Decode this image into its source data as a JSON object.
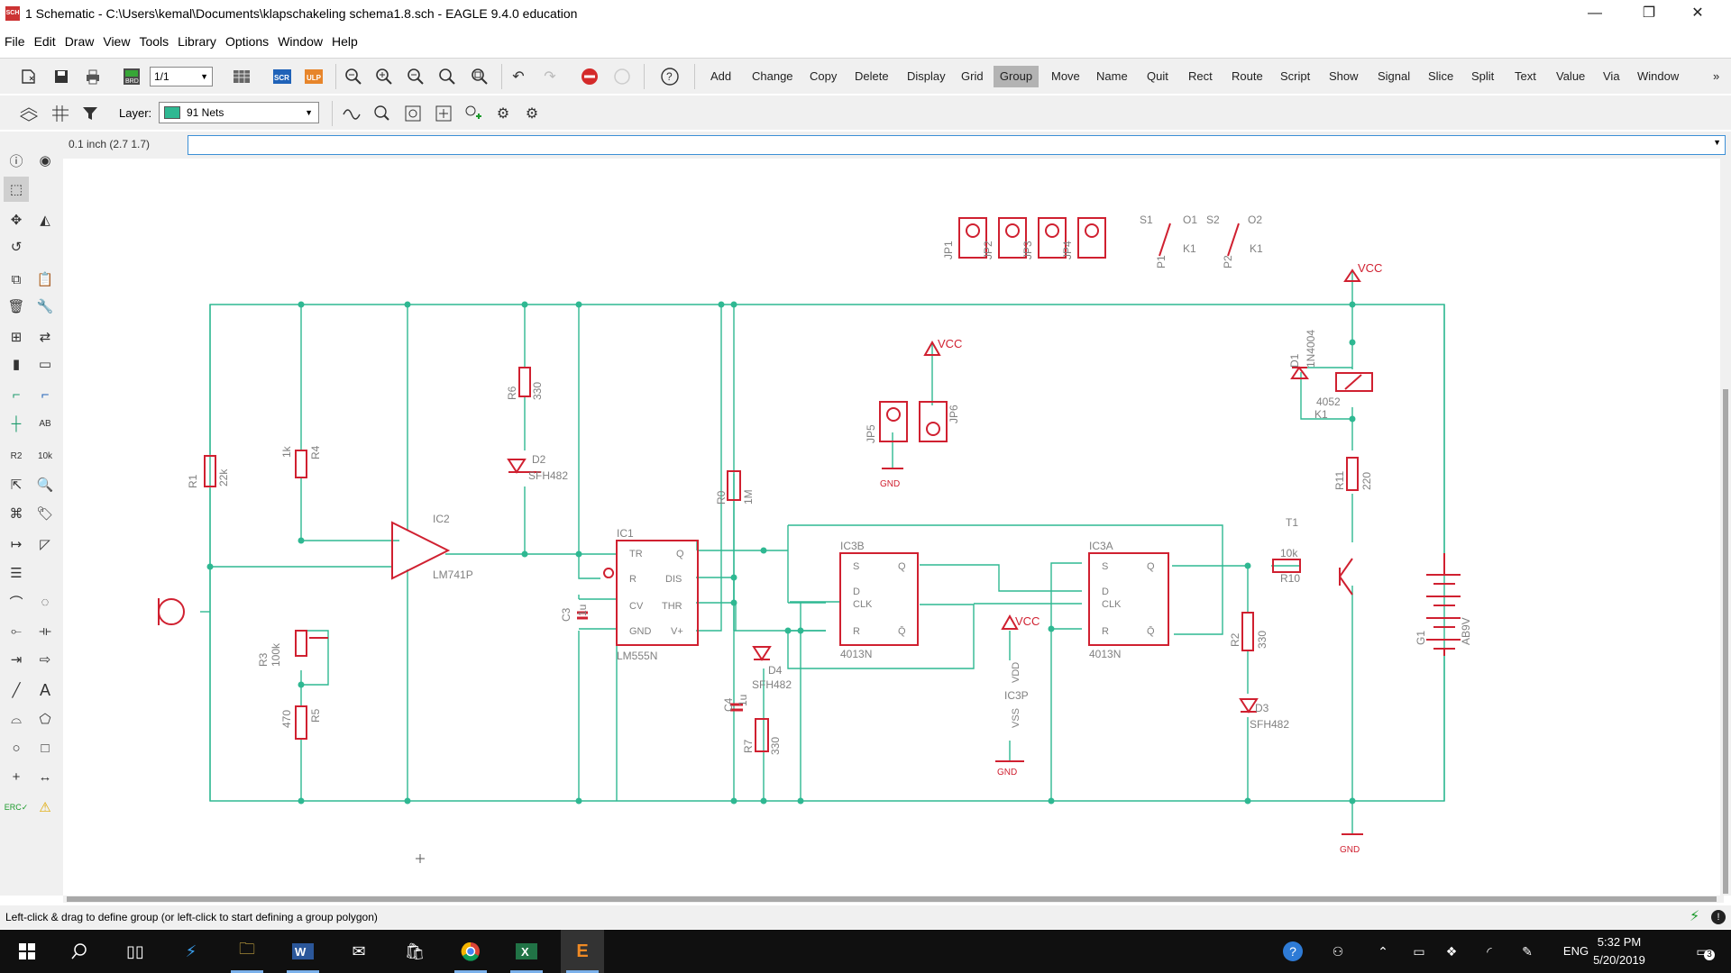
{
  "window": {
    "icon_text": "SCH",
    "title": "1 Schematic - C:\\Users\\kemal\\Documents\\klapschakeling schema1.8.sch - EAGLE 9.4.0 education",
    "minimize": "—",
    "restore": "❐",
    "close": "✕"
  },
  "menu": [
    "File",
    "Edit",
    "Draw",
    "View",
    "Tools",
    "Library",
    "Options",
    "Window",
    "Help"
  ],
  "toolbar": {
    "page_select": "1/1",
    "commands": [
      "Add",
      "Change",
      "Copy",
      "Delete",
      "Display",
      "Grid",
      "Group",
      "Move",
      "Name",
      "Quit",
      "Rect",
      "Route",
      "Script",
      "Show",
      "Signal",
      "Slice",
      "Split",
      "Text",
      "Value",
      "Via",
      "Window"
    ],
    "active_command": "Group",
    "more": "»"
  },
  "layerbar": {
    "label": "Layer:",
    "layer_value": "91 Nets",
    "layer_color": "#2fb892"
  },
  "commandbar": {
    "coordinates": "0.1 inch (2.7 1.7)",
    "input": ""
  },
  "schematic": {
    "wire_color": "#2fb892",
    "part_color": "#d02030",
    "label_color": "#808080",
    "labels": {
      "R1": "R1",
      "R1v": "22k",
      "R4": "R4",
      "R4v": "1k",
      "R3": "R3",
      "R3v": "100k",
      "R5": "R5",
      "R5v": "470",
      "R6": "R6",
      "R6v": "330",
      "R0": "R0",
      "R0v": "1M",
      "R7": "R7",
      "R7v": "330",
      "R2": "R2",
      "R2v": "330",
      "R10": "R10",
      "R10v": "10k",
      "R11": "R11",
      "R11v": "220",
      "IC2": "IC2",
      "IC2v": "LM741P",
      "IC1": "IC1",
      "IC1v": "LM555N",
      "IC3B": "IC3B",
      "IC3Bv": "4013N",
      "IC3A": "IC3A",
      "IC3Av": "4013N",
      "IC3P": "IC3P",
      "D2": "D2",
      "D2v": "SFH482",
      "D4": "D4",
      "D4v": "SFH482",
      "D3": "D3",
      "D3v": "SFH482",
      "D1": "D1",
      "D1v": "1N4004",
      "C3": "C3",
      "C3v": "1u",
      "C4": "C4",
      "C4v": "1u",
      "T1": "T1",
      "G1": "G1",
      "G1v": "AB9V",
      "K1": "K1",
      "K1v": "4052",
      "JP1": "JP1",
      "JP2": "JP2",
      "JP3": "JP3",
      "JP4": "JP4",
      "JP5": "JP5",
      "JP6": "JP6",
      "S1": "S1",
      "S2": "S2",
      "O1": "O1",
      "O2": "O2",
      "P1": "P1",
      "P2": "P2",
      "VCC": "VCC",
      "GND": "GND",
      "pin_TR": "TR",
      "pin_Q": "Q",
      "pin_R": "R",
      "pin_DIS": "DIS",
      "pin_CV": "CV",
      "pin_THR": "THR",
      "pin_GND": "GND",
      "pin_V": "V+",
      "pin_S": "S",
      "pin_D": "D",
      "pin_CLK": "CLK",
      "pin_Qn": "Q̄",
      "pin_VDD": "VDD",
      "pin_VSS": "VSS"
    }
  },
  "status": {
    "message": "Left-click & drag to define group (or left-click to start defining a group polygon)"
  },
  "taskbar": {
    "language": "ENG",
    "time": "5:32 PM",
    "date": "5/20/2019",
    "notifications": "3"
  }
}
